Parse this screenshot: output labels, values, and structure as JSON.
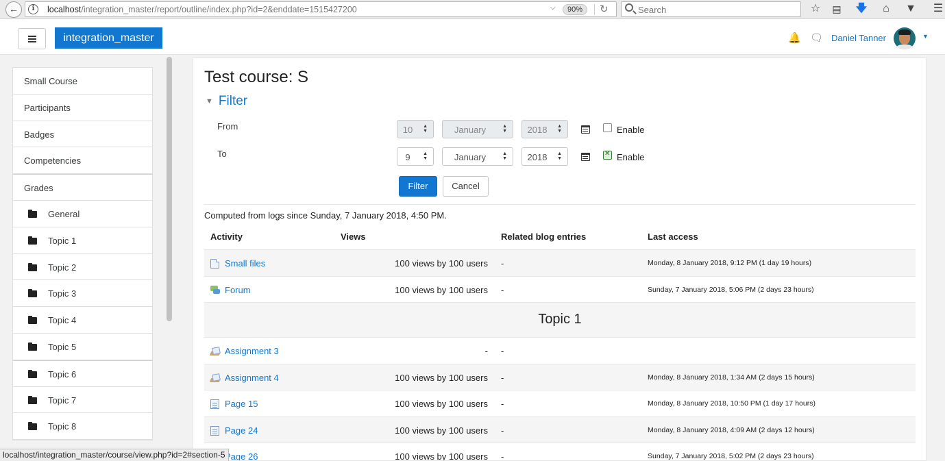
{
  "browser": {
    "url_host": "localhost",
    "url_path": "/integration_master/report/outline/index.php?id=2&enddate=1515427200",
    "zoom": "90%",
    "search_placeholder": "Search"
  },
  "header": {
    "brand": "integration_master",
    "user_name": "Daniel Tanner"
  },
  "nav": {
    "items": [
      {
        "label": "Small Course",
        "type": "node"
      },
      {
        "label": "Participants",
        "type": "node"
      },
      {
        "label": "Badges",
        "type": "node"
      },
      {
        "label": "Competencies",
        "type": "node"
      },
      {
        "label": "Grades",
        "type": "node"
      },
      {
        "label": "General",
        "type": "section"
      },
      {
        "label": "Topic 1",
        "type": "section"
      },
      {
        "label": "Topic 2",
        "type": "section"
      },
      {
        "label": "Topic 3",
        "type": "section"
      },
      {
        "label": "Topic 4",
        "type": "section"
      },
      {
        "label": "Topic 5",
        "type": "section"
      },
      {
        "label": "Topic 6",
        "type": "section"
      },
      {
        "label": "Topic 7",
        "type": "section"
      },
      {
        "label": "Topic 8",
        "type": "section"
      }
    ]
  },
  "page": {
    "title": "Test course: S",
    "filter_legend": "Filter",
    "from_label": "From",
    "to_label": "To",
    "from": {
      "day": "10",
      "month": "January",
      "year": "2018",
      "enabled": false
    },
    "to": {
      "day": "9",
      "month": "January",
      "year": "2018",
      "enabled": true
    },
    "enable_label": "Enable",
    "filter_button": "Filter",
    "cancel_button": "Cancel",
    "computed_text": "Computed from logs since Sunday, 7 January 2018, 4:50 PM."
  },
  "report": {
    "columns": [
      "Activity",
      "Views",
      "Related blog entries",
      "Last access"
    ],
    "rows": [
      {
        "type": "activity",
        "icon": "file-icon",
        "name": "Small files",
        "views": "100 views by 100 users",
        "blog": "-",
        "access": "Monday, 8 January 2018, 9:12 PM (1 day 19 hours)"
      },
      {
        "type": "activity",
        "icon": "forum-icon",
        "name": "Forum",
        "views": "100 views by 100 users",
        "blog": "-",
        "access": "Sunday, 7 January 2018, 5:06 PM (2 days 23 hours)"
      },
      {
        "type": "section",
        "name": "Topic 1"
      },
      {
        "type": "activity",
        "icon": "assignment-icon",
        "name": "Assignment 3",
        "views": "-",
        "blog": "-",
        "access": ""
      },
      {
        "type": "activity",
        "icon": "assignment-icon",
        "name": "Assignment 4",
        "views": "100 views by 100 users",
        "blog": "-",
        "access": "Monday, 8 January 2018, 1:34 AM (2 days 15 hours)"
      },
      {
        "type": "activity",
        "icon": "page-icon",
        "name": "Page 15",
        "views": "100 views by 100 users",
        "blog": "-",
        "access": "Monday, 8 January 2018, 10:50 PM (1 day 17 hours)"
      },
      {
        "type": "activity",
        "icon": "page-icon",
        "name": "Page 24",
        "views": "100 views by 100 users",
        "blog": "-",
        "access": "Monday, 8 January 2018, 4:09 AM (2 days 12 hours)"
      },
      {
        "type": "activity",
        "icon": "page-icon",
        "name": "Page 26",
        "views": "100 views by 100 users",
        "blog": "-",
        "access": "Sunday, 7 January 2018, 5:02 PM (2 days 23 hours)"
      }
    ]
  },
  "status_bar": "localhost/integration_master/course/view.php?id=2#section-5"
}
